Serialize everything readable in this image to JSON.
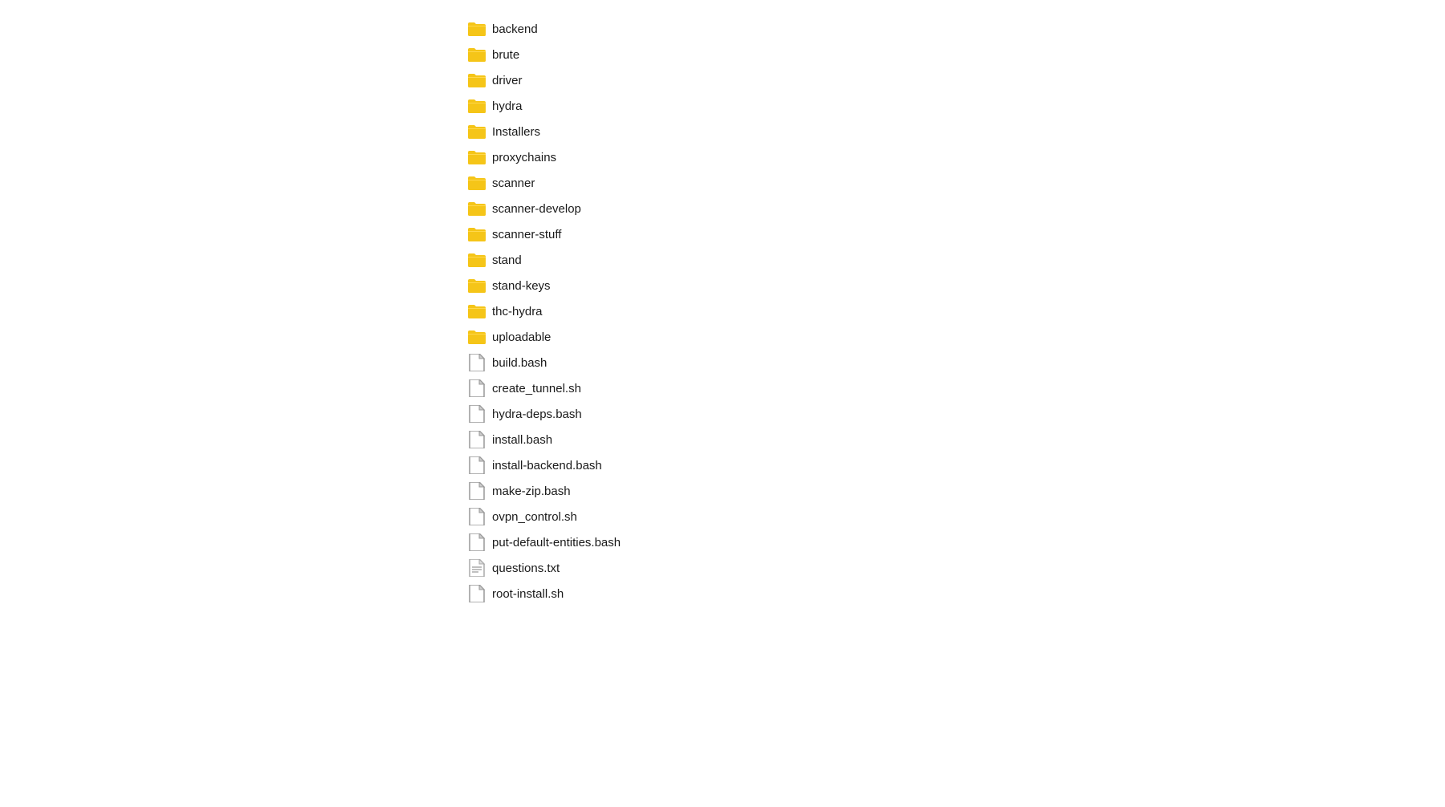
{
  "fileList": {
    "items": [
      {
        "id": "backend",
        "name": "backend",
        "type": "folder"
      },
      {
        "id": "brute",
        "name": "brute",
        "type": "folder"
      },
      {
        "id": "driver",
        "name": "driver",
        "type": "folder"
      },
      {
        "id": "hydra",
        "name": "hydra",
        "type": "folder"
      },
      {
        "id": "Installers",
        "name": "Installers",
        "type": "folder"
      },
      {
        "id": "proxychains",
        "name": "proxychains",
        "type": "folder"
      },
      {
        "id": "scanner",
        "name": "scanner",
        "type": "folder"
      },
      {
        "id": "scanner-develop",
        "name": "scanner-develop",
        "type": "folder"
      },
      {
        "id": "scanner-stuff",
        "name": "scanner-stuff",
        "type": "folder"
      },
      {
        "id": "stand",
        "name": "stand",
        "type": "folder"
      },
      {
        "id": "stand-keys",
        "name": "stand-keys",
        "type": "folder"
      },
      {
        "id": "thc-hydra",
        "name": "thc-hydra",
        "type": "folder"
      },
      {
        "id": "uploadable",
        "name": "uploadable",
        "type": "folder"
      },
      {
        "id": "build.bash",
        "name": "build.bash",
        "type": "file"
      },
      {
        "id": "create_tunnel.sh",
        "name": "create_tunnel.sh",
        "type": "file"
      },
      {
        "id": "hydra-deps.bash",
        "name": "hydra-deps.bash",
        "type": "file"
      },
      {
        "id": "install.bash",
        "name": "install.bash",
        "type": "file"
      },
      {
        "id": "install-backend.bash",
        "name": "install-backend.bash",
        "type": "file"
      },
      {
        "id": "make-zip.bash",
        "name": "make-zip.bash",
        "type": "file"
      },
      {
        "id": "ovpn_control.sh",
        "name": "ovpn_control.sh",
        "type": "file"
      },
      {
        "id": "put-default-entities.bash",
        "name": "put-default-entities.bash",
        "type": "file"
      },
      {
        "id": "questions.txt",
        "name": "questions.txt",
        "type": "text"
      },
      {
        "id": "root-install.sh",
        "name": "root-install.sh",
        "type": "file"
      }
    ]
  },
  "colors": {
    "folderYellow": "#f5c518",
    "folderYellowLight": "#ffd84d",
    "fileGray": "#999999",
    "textColor": "#1a1a1a",
    "background": "#ffffff"
  }
}
